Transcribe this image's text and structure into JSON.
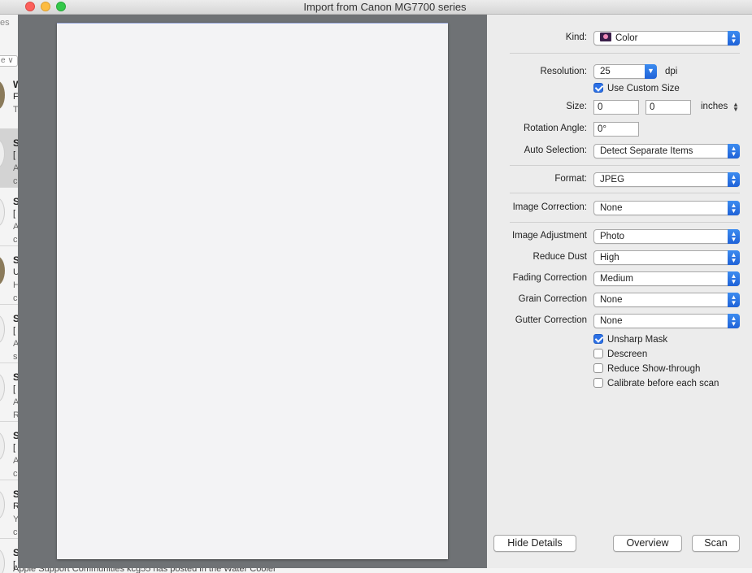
{
  "window": {
    "title": "Import from Canon MG7700 series"
  },
  "background_app": {
    "top_fragment_1": "es",
    "select_fragment": "e ∨",
    "rows": [
      {
        "t1": "W",
        "t2": "F",
        "t3": "T",
        "avatar": true,
        "selected": false
      },
      {
        "t1": "S",
        "t2": "[",
        "t3": "A",
        "t4": "c",
        "avatar": false,
        "selected": true
      },
      {
        "t1": "S",
        "t2": "[",
        "t3": "A",
        "t4": "c",
        "avatar": false,
        "selected": false
      },
      {
        "t1": "S",
        "t2": "U",
        "t3": "H",
        "t4": "c",
        "avatar": true,
        "selected": false
      },
      {
        "t1": "S",
        "t2": "[",
        "t3": "A",
        "t4": "s",
        "avatar": false,
        "selected": false
      },
      {
        "t1": "S",
        "t2": "[",
        "t3": "A",
        "t4": "R",
        "avatar": false,
        "selected": false
      },
      {
        "t1": "S",
        "t2": "[",
        "t3": "A",
        "t4": "c",
        "avatar": false,
        "selected": false
      },
      {
        "t1": "S",
        "t2": "R",
        "t3": "Y",
        "t4": "c",
        "avatar": false,
        "selected": false
      },
      {
        "t1": "S",
        "t2": "[",
        "avatar": false,
        "selected": false
      }
    ],
    "bottom_text": "Apple Support Communities kcg55 has posted in the Water Cooler"
  },
  "settings": {
    "kind": {
      "label": "Kind:",
      "value": "Color",
      "icon": "color-swatch-icon"
    },
    "resolution": {
      "label": "Resolution:",
      "value": "25",
      "unit": "dpi"
    },
    "use_custom_size": {
      "label": "Use Custom Size",
      "checked": true
    },
    "size": {
      "label": "Size:",
      "width": "0",
      "height": "0",
      "unit": "inches"
    },
    "rotation_angle": {
      "label": "Rotation Angle:",
      "value": "0°"
    },
    "auto_selection": {
      "label": "Auto Selection:",
      "value": "Detect Separate Items"
    },
    "format": {
      "label": "Format:",
      "value": "JPEG"
    },
    "image_correction": {
      "label": "Image Correction:",
      "value": "None"
    },
    "image_adjustment": {
      "label": "Image Adjustment",
      "value": "Photo"
    },
    "reduce_dust": {
      "label": "Reduce Dust",
      "value": "High"
    },
    "fading_correction": {
      "label": "Fading Correction",
      "value": "Medium"
    },
    "grain_correction": {
      "label": "Grain Correction",
      "value": "None"
    },
    "gutter_correction": {
      "label": "Gutter Correction",
      "value": "None"
    },
    "unsharp_mask": {
      "label": "Unsharp Mask",
      "checked": true
    },
    "descreen": {
      "label": "Descreen",
      "checked": false
    },
    "reduce_show_through": {
      "label": "Reduce Show-through",
      "checked": false
    },
    "calibrate": {
      "label": "Calibrate before each scan",
      "checked": false
    }
  },
  "buttons": {
    "hide_details": "Hide Details",
    "overview": "Overview",
    "scan": "Scan"
  },
  "colors": {
    "accent": "#2b70e6",
    "preview_bg": "#6f7275",
    "paper": "#f3f3f5"
  }
}
